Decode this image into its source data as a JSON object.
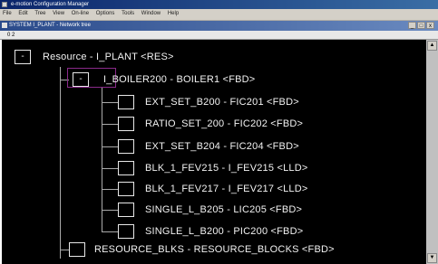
{
  "window": {
    "title": "e-motion Configuration Manager"
  },
  "menu": [
    "File",
    "Edit",
    "Tree",
    "View",
    "On-line",
    "Options",
    "Tools",
    "Window",
    "Help"
  ],
  "child_window": {
    "title": "SYSTEM I_PLANT - Network tree",
    "controls": [
      "_",
      "□",
      "x"
    ]
  },
  "toolbar": {
    "text": "0 2"
  },
  "tree": {
    "root": {
      "toggle": "-",
      "label": "Resource - I_PLANT <RES>"
    },
    "node": {
      "toggle": "-",
      "label": "I_BOILER200 - BOILER1 <FBD>"
    },
    "children": [
      "EXT_SET_B200 - FIC201 <FBD>",
      "RATIO_SET_200 - FIC202 <FBD>",
      "EXT_SET_B204 - FIC204 <FBD>",
      "BLK_1_FEV215 - I_FEV215 <LLD>",
      "BLK_1_FEV217 - I_FEV217 <LLD>",
      "SINGLE_L_B205 - LIC205 <FBD>",
      "SINGLE_L_B200 - PIC200 <FBD>"
    ],
    "sibling": "RESOURCE_BLKS - RESOURCE_BLOCKS <FBD>"
  }
}
